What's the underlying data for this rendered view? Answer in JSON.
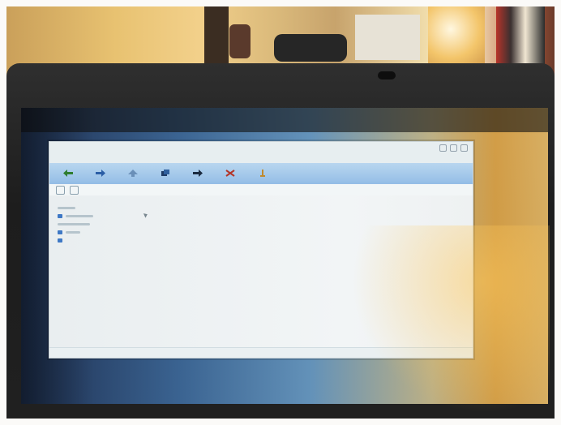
{
  "photo": {
    "subject": "",
    "palette": {
      "bezel": "#1d1d1d",
      "window": "#eaf0f2",
      "toolbar": "#93bde6",
      "warm_light": "#f0b24d"
    }
  },
  "app": {
    "title": "",
    "menu": [],
    "toolbar": [
      {
        "icon": "back-arrow-icon",
        "label": ""
      },
      {
        "icon": "forward-arrow-icon",
        "label": ""
      },
      {
        "icon": "up-arrow-icon",
        "label": ""
      },
      {
        "icon": "copy-icon",
        "label": ""
      },
      {
        "icon": "move-icon",
        "label": ""
      },
      {
        "icon": "delete-icon",
        "label": ""
      },
      {
        "icon": "info-icon",
        "label": ""
      }
    ],
    "status": ""
  }
}
